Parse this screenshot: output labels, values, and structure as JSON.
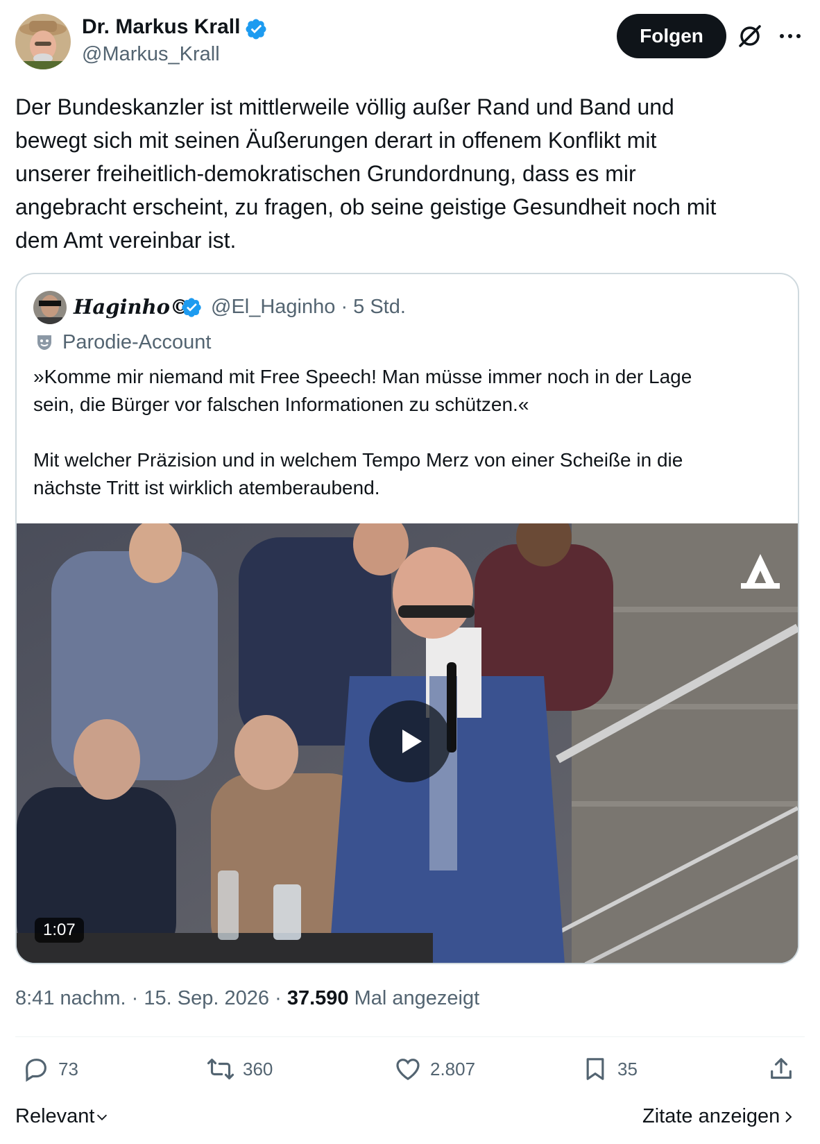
{
  "author": {
    "name": "Dr. Markus Krall",
    "handle": "@Markus_Krall",
    "verified": true
  },
  "header": {
    "follow_label": "Folgen"
  },
  "tweet": {
    "text": "Der Bundeskanzler ist mittlerweile völlig außer Rand und Band und\nbewegt sich mit seinen Äußerungen derart in offenem Konflikt mit\nunserer freiheitlich-demokratischen Grundordnung, dass es mir\nangebracht erscheint, zu fragen, ob seine geistige Gesundheit noch mit\ndem Amt vereinbar ist."
  },
  "quote": {
    "name": "Haginho©",
    "meta": "@El_Haginho · 5 Std.",
    "parody_label": "Parodie-Account",
    "text": "»Komme mir niemand mit Free Speech! Man müsse immer noch in der Lage\nsein, die Bürger vor falschen Informationen zu schützen.«\n\nMit welcher Präzision und in welchem Tempo Merz von einer Scheiße in die\nnächste Tritt ist wirklich atemberaubend.",
    "video": {
      "duration": "1:07"
    }
  },
  "meta": {
    "time": "8:41 nachm.",
    "date": "15. Sep. 2026",
    "separator": "·",
    "views": "37.590",
    "views_label": "Mal angezeigt"
  },
  "actions": {
    "replies": "73",
    "retweets": "360",
    "likes": "2.807",
    "bookmarks": "35"
  },
  "footer": {
    "sort_label": "Relevant",
    "quotes_label": "Zitate anzeigen"
  },
  "colors": {
    "text": "#0f1419",
    "secondary": "#536471",
    "verified": "#1d9bf0",
    "border": "#cfd9de"
  }
}
